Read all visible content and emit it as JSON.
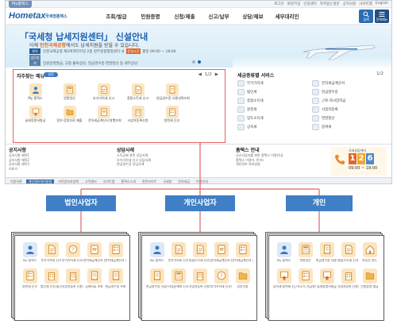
{
  "site": {
    "util_tag": "My홈택스",
    "util_links": [
      "로그인",
      "회원가입",
      "인증센터",
      "자주묻는질문",
      "공지사항",
      "사이트맵",
      "English"
    ],
    "logo_brand": "Hometax",
    "logo_sub": "국세청홈택스",
    "menu": [
      "조회/발급",
      "민원증명",
      "신청/제출",
      "신고/납부",
      "상담/제보",
      "세무대리인"
    ],
    "search_label": "검색",
    "allmenu_label": "전체메뉴"
  },
  "banner": {
    "headline": "「국세청 납세지원센터」 신설안내",
    "subline_pre": "이제 ",
    "subline_hl": "인천국제공항",
    "subline_post": "에서도 납세지원을 받을 수 있습니다.",
    "row1_tag": "위치",
    "row1_text": "인천국제공항 제2여객터미널 2층 정부종합행정센터 내",
    "row1_badge": "운영시간",
    "row1_time": "평일 09:00 ~ 18:00",
    "row2_tag": "업무범위",
    "row2_text": "민원증명발급, 고충·불복상담, 현금영수증·연말정산 등 세무상담"
  },
  "favorites": {
    "title": "자주찾는 메뉴",
    "toggle": "설정",
    "page": "1/2",
    "items": [
      {
        "label": "My 홈택스",
        "icon": "person-icon"
      },
      {
        "label": "연말정산",
        "icon": "calculator-icon"
      },
      {
        "label": "부가가치세 신고",
        "icon": "document-icon"
      },
      {
        "label": "종합소득세 신고",
        "icon": "document-icon"
      },
      {
        "label": "현금영수증 사용내역조회",
        "icon": "receipt-icon"
      },
      {
        "label": "",
        "icon": ""
      },
      {
        "label": "납세증명서발급",
        "icon": "certificate-icon"
      },
      {
        "label": "장부·증빙자료 제출",
        "icon": "folder-icon"
      },
      {
        "label": "전자세금계산서 발행조회",
        "icon": "invoice-icon"
      },
      {
        "label": "사업자등록신청",
        "icon": "building-icon"
      },
      {
        "label": "원천세 신고",
        "icon": "form-icon"
      },
      {
        "label": "",
        "icon": ""
      }
    ]
  },
  "category": {
    "title": "세금종류별 서비스",
    "page": "1/2",
    "items": [
      "부가가치세",
      "전자세금계산서",
      "법인세",
      "현금영수증",
      "종합소득세",
      "근로·자녀장려금",
      "원천세",
      "사업자등록",
      "양도소득세",
      "연말정산",
      "상속세",
      "증여세"
    ]
  },
  "lower": {
    "notice_title": "공지사항",
    "notice_lines": [
      "공지사항 제목1",
      "공지사항 제목2",
      "공지사항 제목3",
      "더보기"
    ],
    "counsel_title": "상담사례",
    "counsel_lines": [
      "소득공제 관련 상담사례",
      "부가가치세 신고 상담사례",
      "현금영수증 상담사례"
    ],
    "guide_title": "홈택스 안내",
    "guide_lines": [
      "신규사업자를 위한 홈택스 이용안내",
      "홈택스 이용자 가이드",
      "개인정보 처리방침"
    ],
    "call_title": "국세상담센터",
    "call_number": [
      "1",
      "2",
      "6"
    ],
    "call_hours": "09:00 ~ 18:00"
  },
  "footer": [
    "이용약관",
    "개인정보처리방침",
    "저작권보호정책",
    "고객센터",
    "사이트맵",
    "홈택스소개",
    "관련사이트",
    "국세청",
    "전자세금",
    "이용안내"
  ],
  "sections": [
    {
      "label": "법인사업자",
      "items": [
        {
          "label": "My 홈택스",
          "icon": "person-icon"
        },
        {
          "label": "부가가치세 신고",
          "icon": "document-icon"
        },
        {
          "label": "부가가치세 신고도움서비스",
          "icon": "help-icon"
        },
        {
          "label": "전자세금계산서 발행조회",
          "icon": "invoice-icon"
        },
        {
          "label": "전자세금계산서 건별발급",
          "icon": "form-icon"
        },
        {
          "label": "원천세 신고",
          "icon": "form-icon"
        },
        {
          "label": "법인세 신고(중간예납)",
          "icon": "building-icon"
        },
        {
          "label": "사업자등록 신청조회",
          "icon": "building-icon"
        },
        {
          "label": "공제서류 조회",
          "icon": "receipt-icon"
        },
        {
          "label": "현금영수증 조회",
          "icon": "receipt-icon"
        }
      ]
    },
    {
      "label": "개인사업자",
      "items": [
        {
          "label": "My 홈택스",
          "icon": "person-icon"
        },
        {
          "label": "부가가치세 신고",
          "icon": "document-icon"
        },
        {
          "label": "종합소득세 신고(간편)",
          "icon": "document-icon"
        },
        {
          "label": "전자세금계산서 발행조회",
          "icon": "invoice-icon"
        },
        {
          "label": "전자세금계산서 건별발급",
          "icon": "form-icon"
        },
        {
          "label": "현금영수증 사업자조회",
          "icon": "receipt-icon"
        },
        {
          "label": "사업용계좌 신고",
          "icon": "calculator-icon"
        },
        {
          "label": "사업자등록 신청조회",
          "icon": "building-icon"
        },
        {
          "label": "부가가치세 신고도움",
          "icon": "help-icon"
        },
        {
          "label": "장부작성",
          "icon": "folder-icon"
        }
      ]
    },
    {
      "label": "개인",
      "items": [
        {
          "label": "My 홈택스",
          "icon": "person-icon"
        },
        {
          "label": "연말정산",
          "icon": "calculator-icon"
        },
        {
          "label": "현금영수증 사용내역조회",
          "icon": "receipt-icon"
        },
        {
          "label": "종합소득세 신고",
          "icon": "document-icon"
        },
        {
          "label": "부동산 양도",
          "icon": "home-icon"
        },
        {
          "label": "상속세·증여세 신고",
          "icon": "certificate-icon"
        },
        {
          "label": "근로소득 지급명세서",
          "icon": "form-icon"
        },
        {
          "label": "납세증명서발급",
          "icon": "certificate-icon"
        },
        {
          "label": "사업자등록 신청조회",
          "icon": "building-icon"
        },
        {
          "label": "민원증명 발급",
          "icon": "folder-icon"
        }
      ]
    }
  ],
  "colors": {
    "brand": "#1f5fa6",
    "highlight_border": "#e06464",
    "section_tab": "#3f7fc6",
    "icon_bg": "#fbe5c1"
  }
}
